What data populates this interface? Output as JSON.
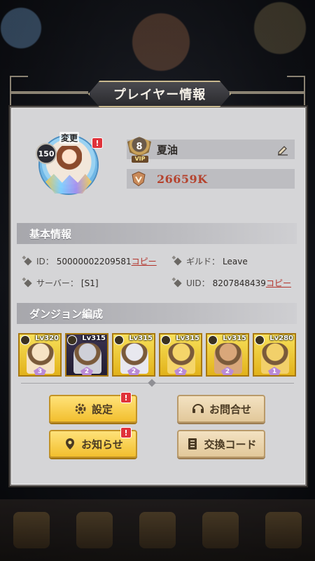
{
  "header": {
    "title": "プレイヤー情報"
  },
  "profile": {
    "avatar_level": "150",
    "change_label": "変更",
    "vip_level": "8",
    "vip_label": "VIP",
    "player_name": "夏油",
    "power": "26659K"
  },
  "basic_info": {
    "section_title": "基本情報",
    "id_label": "ID：",
    "id_value": "50000002209581",
    "id_copy": "コピー",
    "guild_label": "ギルド：",
    "guild_value": "Leave",
    "server_label": "サーバー：",
    "server_value": "[S1]",
    "uid_label": "UID：",
    "uid_value": "8207848439",
    "uid_copy": "コピー"
  },
  "dungeon": {
    "section_title": "ダンジョン編成",
    "heroes": [
      {
        "level": "Lv320",
        "stars": "3",
        "style": "gold",
        "art": "#f6e3c4"
      },
      {
        "level": "Lv315",
        "stars": "2",
        "style": "dark",
        "art": "#cfd0d8"
      },
      {
        "level": "Lv315",
        "stars": "2",
        "style": "gold",
        "art": "#e8e8ef"
      },
      {
        "level": "Lv315",
        "stars": "2",
        "style": "gold",
        "art": "#f5d56a"
      },
      {
        "level": "Lv315",
        "stars": "2",
        "style": "gold",
        "art": "#d9a77a"
      },
      {
        "level": "Lv280",
        "stars": "1",
        "style": "gold",
        "art": "#f2d06a"
      }
    ]
  },
  "buttons": {
    "settings": "設定",
    "contact": "お問合せ",
    "news": "お知らせ",
    "redeem": "交換コード"
  },
  "alert_mark": "!",
  "colors": {
    "accent_gold": "#f2bf2e",
    "copy_link": "#b3332b",
    "power": "#b5432e"
  }
}
